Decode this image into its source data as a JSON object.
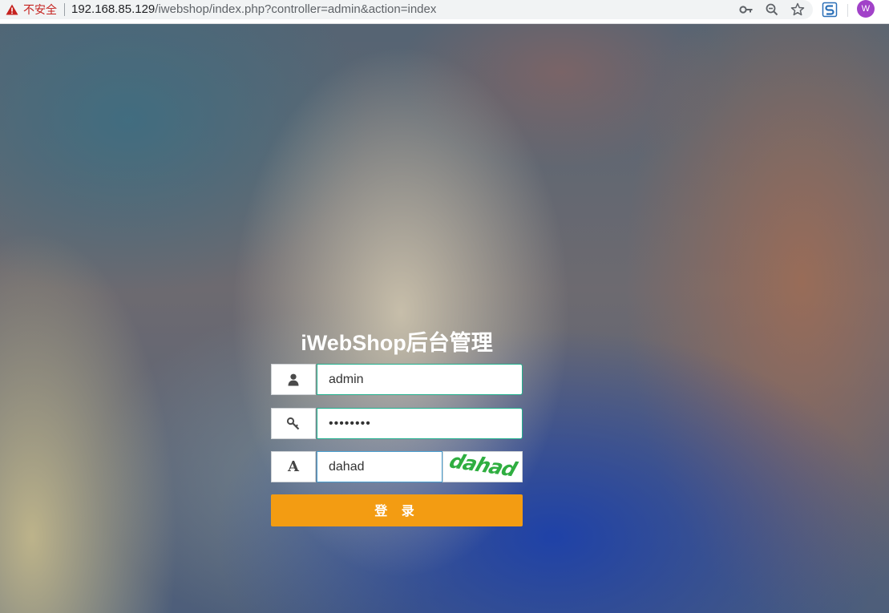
{
  "browser": {
    "security_label": "不安全",
    "url_host": "192.168.85.129",
    "url_path": "/iwebshop/index.php?controller=admin&action=index",
    "profile_initial": "W",
    "icons": [
      "warning-icon",
      "key-icon",
      "zoom-out-icon",
      "star-icon",
      "extension-icon",
      "avatar"
    ]
  },
  "login": {
    "title": "iWebShop后台管理",
    "username": {
      "icon": "user-icon",
      "value": "admin"
    },
    "password": {
      "icon": "key-icon",
      "value": "••••••••"
    },
    "captcha": {
      "icon_letter": "A",
      "value": "dahad",
      "image_text": "dahad"
    },
    "submit_label": "登 录"
  },
  "colors": {
    "input_border": "#21b08e",
    "captcha_border": "#4a9fd0",
    "button_bg": "#f39c12",
    "captcha_text": "#2fae40",
    "insecure": "#c5221f"
  }
}
